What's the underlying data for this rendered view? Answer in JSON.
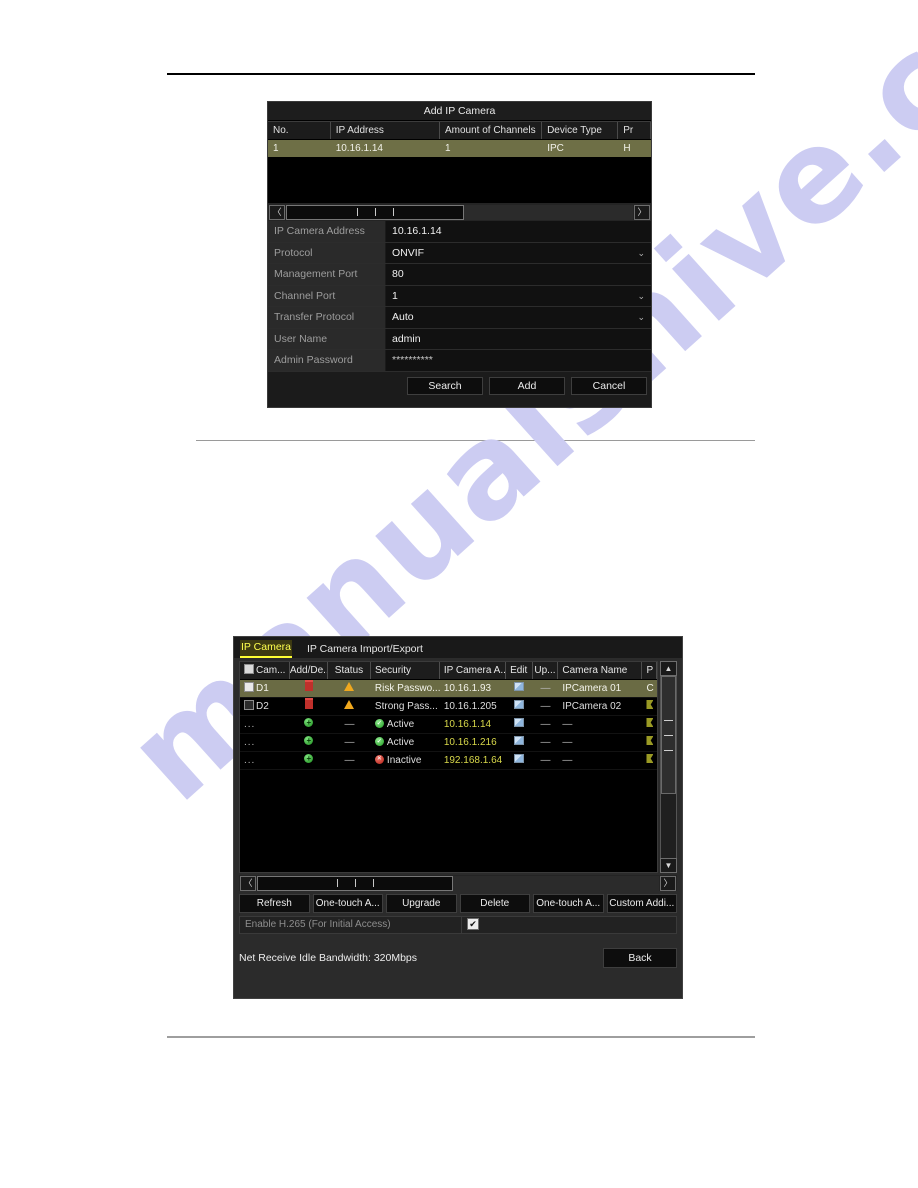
{
  "page": {
    "watermark": "manualshive.com"
  },
  "dialog_add_ip_camera": {
    "title": "Add IP Camera",
    "table": {
      "columns": [
        "No.",
        "IP Address",
        "Amount of Channels",
        "Device Type",
        "Pr"
      ],
      "rows": [
        {
          "no": "1",
          "ip": "10.16.1.14",
          "channels": "1",
          "device_type": "IPC",
          "protocol": "H"
        }
      ]
    },
    "scroll": {
      "left_icon": "chevron-left-icon",
      "right_icon": "chevron-right-icon"
    },
    "fields": [
      {
        "label": "IP Camera Address",
        "value": "10.16.1.14",
        "type": "text"
      },
      {
        "label": "Protocol",
        "value": "ONVIF",
        "type": "select"
      },
      {
        "label": "Management Port",
        "value": "80",
        "type": "text"
      },
      {
        "label": "Channel Port",
        "value": "1",
        "type": "select"
      },
      {
        "label": "Transfer Protocol",
        "value": "Auto",
        "type": "select"
      },
      {
        "label": "User Name",
        "value": "admin",
        "type": "text"
      },
      {
        "label": "Admin Password",
        "value": "**********",
        "type": "password"
      }
    ],
    "buttons": {
      "search": "Search",
      "add": "Add",
      "cancel": "Cancel"
    }
  },
  "dialog_ip_camera_manage": {
    "tabs": [
      {
        "label": "IP Camera",
        "active": true
      },
      {
        "label": "IP Camera Import/Export",
        "active": false
      }
    ],
    "table": {
      "columns": [
        "Cam...",
        "Add/De...",
        "Status",
        "Security",
        "IP Camera A...",
        "Edit",
        "Up...",
        "Camera Name",
        "P"
      ],
      "rows": [
        {
          "channel": "D1",
          "add_delete": "delete-icon",
          "status": "warning-icon",
          "security": "Risk Passwo...",
          "ip": "10.16.1.93",
          "edit": "edit-icon",
          "upgrade": "—",
          "name": "IPCamera 01",
          "protocol": "C",
          "highlighted": true
        },
        {
          "channel": "D2",
          "add_delete": "delete-icon",
          "status": "warning-icon",
          "security": "Strong Pass...",
          "ip": "10.16.1.205",
          "edit": "edit-icon",
          "upgrade": "—",
          "name": "IPCamera 02",
          "protocol": "H",
          "highlighted": false
        },
        {
          "channel": "...",
          "add_delete": "add-icon",
          "status": "—",
          "security": "Active",
          "security_state": "active",
          "ip": "10.16.1.14",
          "edit": "edit-icon",
          "upgrade": "—",
          "name": "—",
          "protocol": "H",
          "highlighted": false
        },
        {
          "channel": "...",
          "add_delete": "add-icon",
          "status": "—",
          "security": "Active",
          "security_state": "active",
          "ip": "10.16.1.216",
          "edit": "edit-icon",
          "upgrade": "—",
          "name": "—",
          "protocol": "H",
          "highlighted": false
        },
        {
          "channel": "...",
          "add_delete": "add-icon",
          "status": "—",
          "security": "Inactive",
          "security_state": "inactive",
          "ip": "192.168.1.64",
          "edit": "edit-icon",
          "upgrade": "—",
          "name": "—",
          "protocol": "H",
          "highlighted": false
        }
      ]
    },
    "buttons": {
      "refresh": "Refresh",
      "one_touch_activate": "One-touch A...",
      "upgrade": "Upgrade",
      "delete": "Delete",
      "one_touch_add": "One-touch A...",
      "custom_adding": "Custom Addi...",
      "back": "Back"
    },
    "h265": {
      "label": "Enable H.265 (For Initial Access)",
      "checked": true
    },
    "bandwidth": "Net Receive Idle Bandwidth: 320Mbps"
  }
}
